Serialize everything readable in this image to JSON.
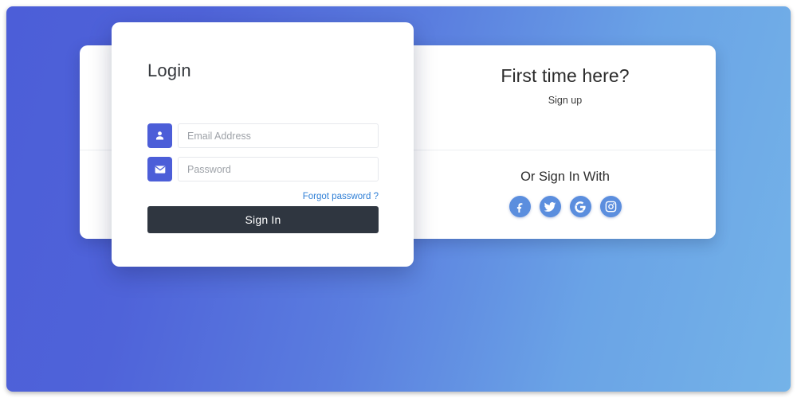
{
  "theme": {
    "gradient_start": "#4c5ed8",
    "gradient_end": "#74b3e8",
    "accent_indigo": "#4c5ed8",
    "social_blue": "#5b8ede",
    "button_dark": "#2f3640",
    "link_blue": "#2f7fd6"
  },
  "login_card": {
    "title": "Login",
    "email_field": {
      "placeholder": "Email Address",
      "value": "",
      "icon": "user-icon"
    },
    "password_field": {
      "placeholder": "Password",
      "value": "",
      "icon": "envelope-icon"
    },
    "forgot_link": "Forgot password ?",
    "submit_label": "Sign In"
  },
  "side_panel": {
    "signup": {
      "title": "First time here?",
      "link": "Sign up"
    },
    "social": {
      "title": "Or Sign In With",
      "buttons": [
        {
          "name": "facebook",
          "icon": "facebook-icon",
          "label": "f"
        },
        {
          "name": "twitter",
          "icon": "twitter-icon",
          "label": "t"
        },
        {
          "name": "google",
          "icon": "google-icon",
          "label": "G"
        },
        {
          "name": "instagram",
          "icon": "instagram-icon",
          "label": "ig"
        }
      ]
    }
  }
}
